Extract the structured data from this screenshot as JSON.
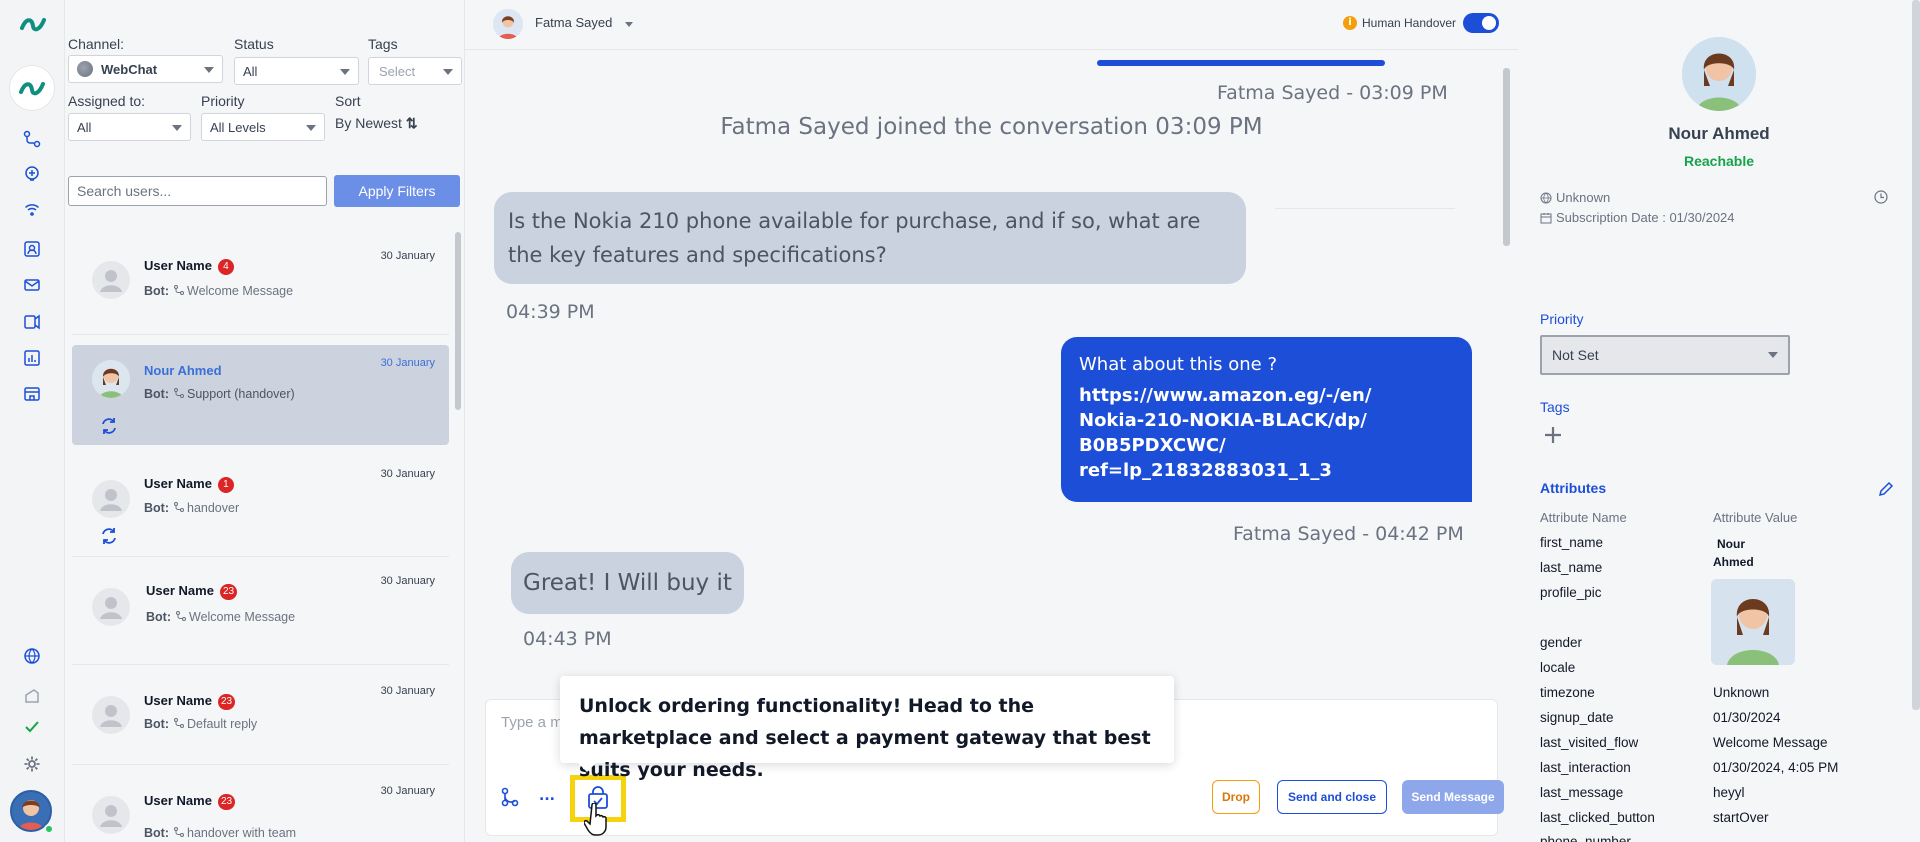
{
  "filters": {
    "channel_label": "Channel:",
    "channel_value": "WebChat",
    "status_label": "Status",
    "status_value": "All",
    "tags_label": "Tags",
    "tags_placeholder": "Select",
    "assigned_label": "Assigned to:",
    "assigned_value": "All",
    "priority_label": "Priority",
    "priority_value": "All Levels",
    "sort_label": "Sort",
    "sort_value": "By Newest",
    "search_placeholder": "Search users...",
    "apply_label": "Apply Filters"
  },
  "conversations": [
    {
      "name": "User Name",
      "badge": "4",
      "bot_label": "Bot:",
      "flow": "Welcome Message",
      "date": "30 January"
    },
    {
      "name": "Nour Ahmed",
      "bot_label": "Bot:",
      "flow": "Support (handover)",
      "date": "30 January"
    },
    {
      "name": "User Name",
      "badge": "1",
      "bot_label": "Bot:",
      "flow": "handover",
      "date": "30 January"
    },
    {
      "name": "User Name",
      "badge": "23",
      "bot_label": "Bot:",
      "flow": "Welcome Message",
      "date": "30 January"
    },
    {
      "name": "User Name",
      "badge": "23",
      "bot_label": "Bot:",
      "flow": "Default reply",
      "date": "30 January"
    },
    {
      "name": "User Name",
      "badge": "23",
      "bot_label": "Bot:",
      "flow": "handover with team",
      "date": "30 January"
    }
  ],
  "chat": {
    "agent_name": "Fatma Sayed",
    "handover_label": "Human Handover",
    "handover_on": true,
    "info_glyph": "i",
    "meta_top": "Fatma Sayed - 03:09 PM",
    "system_message": "Fatma Sayed joined the conversation 03:09 PM",
    "msg_in_1": "Is the Nokia 210 phone available for purchase, and if so, what are the key features and specifications?",
    "time_1": "04:39 PM",
    "msg_out_question": "What about this one ?",
    "msg_out_link": "https://www.amazon.eg/-/en/Nokia-210-NOKIA-BLACK/dp/B0B5PDXCWC/ref=lp_21832883031_1_3",
    "msg_out_link_lines": [
      "https://www.amazon.eg/-/en/",
      "Nokia-210-NOKIA-BLACK/dp/",
      "B0B5PDXCWC/",
      "ref=lp_21832883031_1_3"
    ],
    "meta_out": "Fatma Sayed - 04:42 PM",
    "msg_in_2": "Great! I Will buy it",
    "time_2": "04:43 PM",
    "composer_placeholder": "Type a m",
    "more_label": "...",
    "drop_label": "Drop",
    "send_close_label": "Send and close",
    "send_label": "Send Message",
    "tooltip": "Unlock ordering functionality! Head to the marketplace and select a payment gateway that best suits your needs."
  },
  "contact": {
    "name": "Nour Ahmed",
    "status": "Reachable",
    "location": "Unknown",
    "subscription": "Subscription Date : 01/30/2024",
    "priority_title": "Priority",
    "priority_value": "Not Set",
    "tags_title": "Tags",
    "attributes_title": "Attributes",
    "attr_name_header": "Attribute Name",
    "attr_value_header": "Attribute Value",
    "attributes": [
      {
        "key": "first_name",
        "value": "Nour"
      },
      {
        "key": "last_name",
        "value": "Ahmed"
      },
      {
        "key": "profile_pic",
        "value": ""
      },
      {
        "key": "gender",
        "value": ""
      },
      {
        "key": "locale",
        "value": ""
      },
      {
        "key": "timezone",
        "value": "Unknown"
      },
      {
        "key": "signup_date",
        "value": "01/30/2024"
      },
      {
        "key": "last_visited_flow",
        "value": "Welcome Message"
      },
      {
        "key": "last_interaction",
        "value": "01/30/2024, 4:05 PM"
      },
      {
        "key": "last_message",
        "value": "heyyl"
      },
      {
        "key": "last_clicked_button",
        "value": "startOver"
      },
      {
        "key": "phone_number",
        "value": ""
      }
    ]
  },
  "colors": {
    "accent": "#1d4ed8",
    "badge": "#dc2626",
    "reachable": "#16a34a",
    "highlight": "#f5d40f"
  }
}
